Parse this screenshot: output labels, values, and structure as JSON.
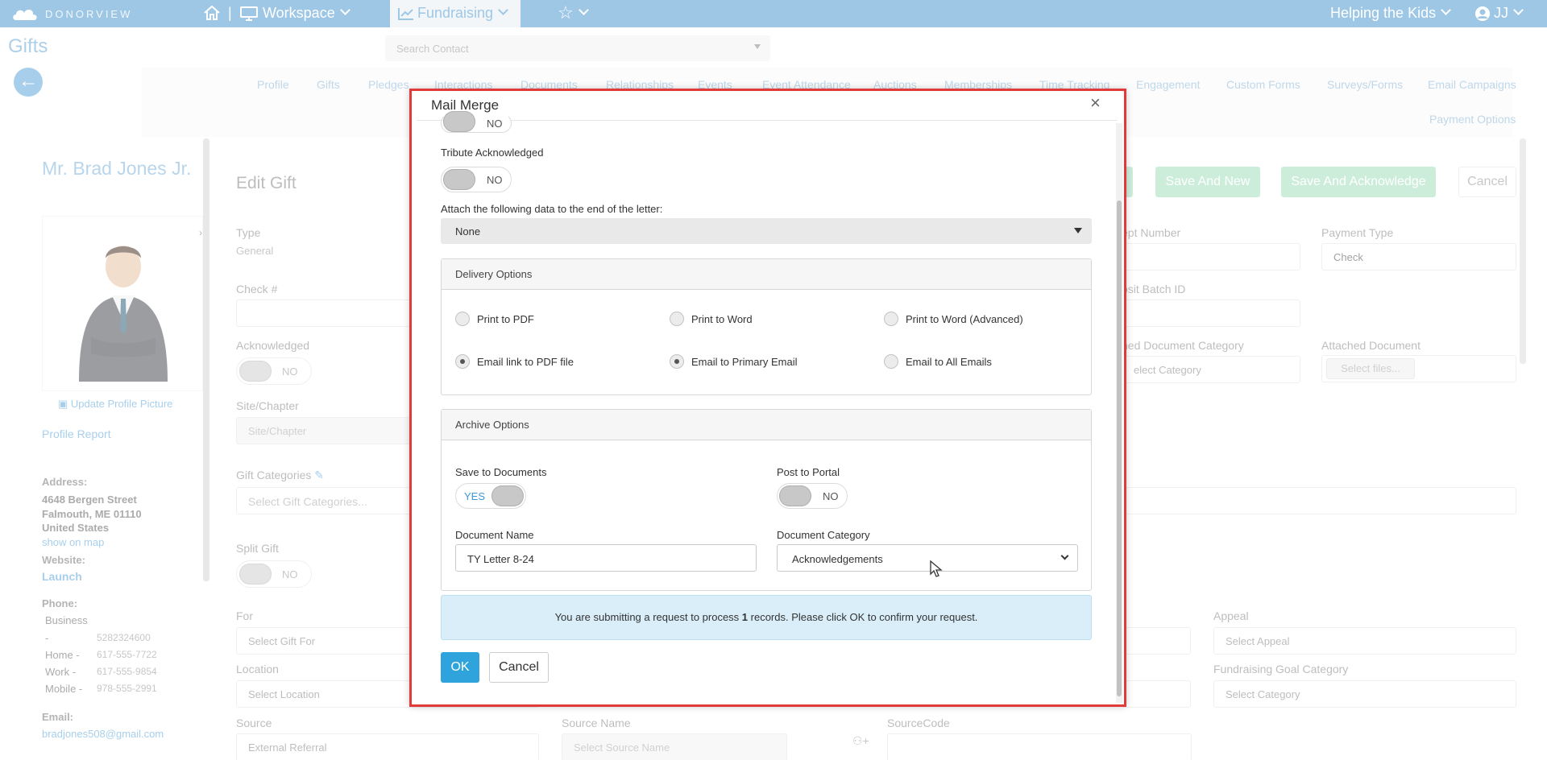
{
  "topbar": {
    "logo_text": "DONORVIEW",
    "workspace_label": "Workspace",
    "fundraising_label": "Fundraising",
    "org_label": "Helping the Kids",
    "user_label": "JJ"
  },
  "page": {
    "title": "Gifts",
    "search_placeholder": "Search Contact"
  },
  "tabs": [
    "Profile",
    "Gifts",
    "Pledges",
    "Interactions",
    "Documents",
    "Relationships",
    "Events",
    "Event Attendance",
    "Auctions",
    "Memberships",
    "Time Tracking",
    "Engagement",
    "Custom Forms",
    "Surveys/Forms",
    "Email Campaigns",
    "Payment Options"
  ],
  "profile": {
    "name": "Mr. Brad Jones Jr.",
    "update_picture": "Update Profile Picture",
    "profile_report": "Profile Report",
    "address_label": "Address:",
    "address_line1": "4648 Bergen Street",
    "address_line2": "Falmouth, ME 01110",
    "address_line3": "United States",
    "show_on_map": "show on map",
    "website_label": "Website:",
    "website_link": "Launch",
    "phone_label": "Phone:",
    "phone_business_label": "Business",
    "phone_business_dash": "-",
    "phone_business": "5282324600",
    "phone_home_label": "Home -",
    "phone_home": "617-555-7722",
    "phone_work_label": "Work -",
    "phone_work": "617-555-9854",
    "phone_mobile_label": "Mobile -",
    "phone_mobile": "978-555-2991",
    "email_label": "Email:",
    "email": "bradjones508@gmail.com"
  },
  "edit_gift": {
    "title": "Edit Gift",
    "type_label": "Type",
    "type_value": "General",
    "check_label": "Check #",
    "acknowledged_label": "Acknowledged",
    "toggle_no": "NO",
    "site_label": "Site/Chapter",
    "site_placeholder": "Site/Chapter",
    "gift_categories_label": "Gift Categories",
    "gift_categories_placeholder": "Select Gift Categories...",
    "split_gift_label": "Split Gift",
    "for_label": "For",
    "for_placeholder": "Select Gift For",
    "location_label": "Location",
    "location_placeholder": "Select Location",
    "source_label": "Source",
    "source_value": "External Referral",
    "source_name_label": "Source Name",
    "source_name_placeholder": "Select Source Name",
    "source_code_label": "SourceCode",
    "receipt_label": "ept Number",
    "payment_type_label": "Payment Type",
    "payment_type_value": "Check",
    "deposit_label": "osit Batch ID",
    "attached_cat_label": "hed Document Category",
    "attached_cat_placeholder": "elect Category",
    "attached_doc_label": "Attached Document",
    "select_files": "Select files...",
    "appeal_label": "Appeal",
    "appeal_placeholder": "Select Appeal",
    "goal_cat_label": "Fundraising Goal Category",
    "goal_cat_placeholder": "Select Category",
    "save_and_new": "Save And New",
    "save_and_ack": "Save And Acknowledge",
    "cancel": "Cancel"
  },
  "modal": {
    "title": "Mail Merge",
    "close": "×",
    "top_toggle_text": "NO",
    "tribute_label": "Tribute Acknowledged",
    "tribute_toggle": "NO",
    "attach_label": "Attach the following data to the end of the letter:",
    "attach_value": "None",
    "delivery": {
      "title": "Delivery Options",
      "options": [
        {
          "label": "Print to PDF",
          "selected": false
        },
        {
          "label": "Print to Word",
          "selected": false
        },
        {
          "label": "Print to Word (Advanced)",
          "selected": false
        },
        {
          "label": "Email link to PDF file",
          "selected": true
        },
        {
          "label": "Email to Primary Email",
          "selected": true
        },
        {
          "label": "Email to All Emails",
          "selected": false
        }
      ]
    },
    "archive": {
      "title": "Archive Options",
      "save_docs_label": "Save to Documents",
      "save_docs_toggle": "YES",
      "post_portal_label": "Post to Portal",
      "post_portal_toggle": "NO",
      "doc_name_label": "Document Name",
      "doc_name_value": "TY Letter 8-24",
      "doc_cat_label": "Document Category",
      "doc_cat_value": "Acknowledgements"
    },
    "alert_pre": "You are submitting a request to process ",
    "alert_count": "1",
    "alert_post": " records. Please click OK to confirm your request.",
    "ok": "OK",
    "cancel": "Cancel"
  },
  "colors": {
    "brand_blue": "#4f9ad2",
    "ok_blue": "#2fa4dc",
    "highlight_red": "#e03a3a",
    "save_green": "#a5dfbe"
  }
}
